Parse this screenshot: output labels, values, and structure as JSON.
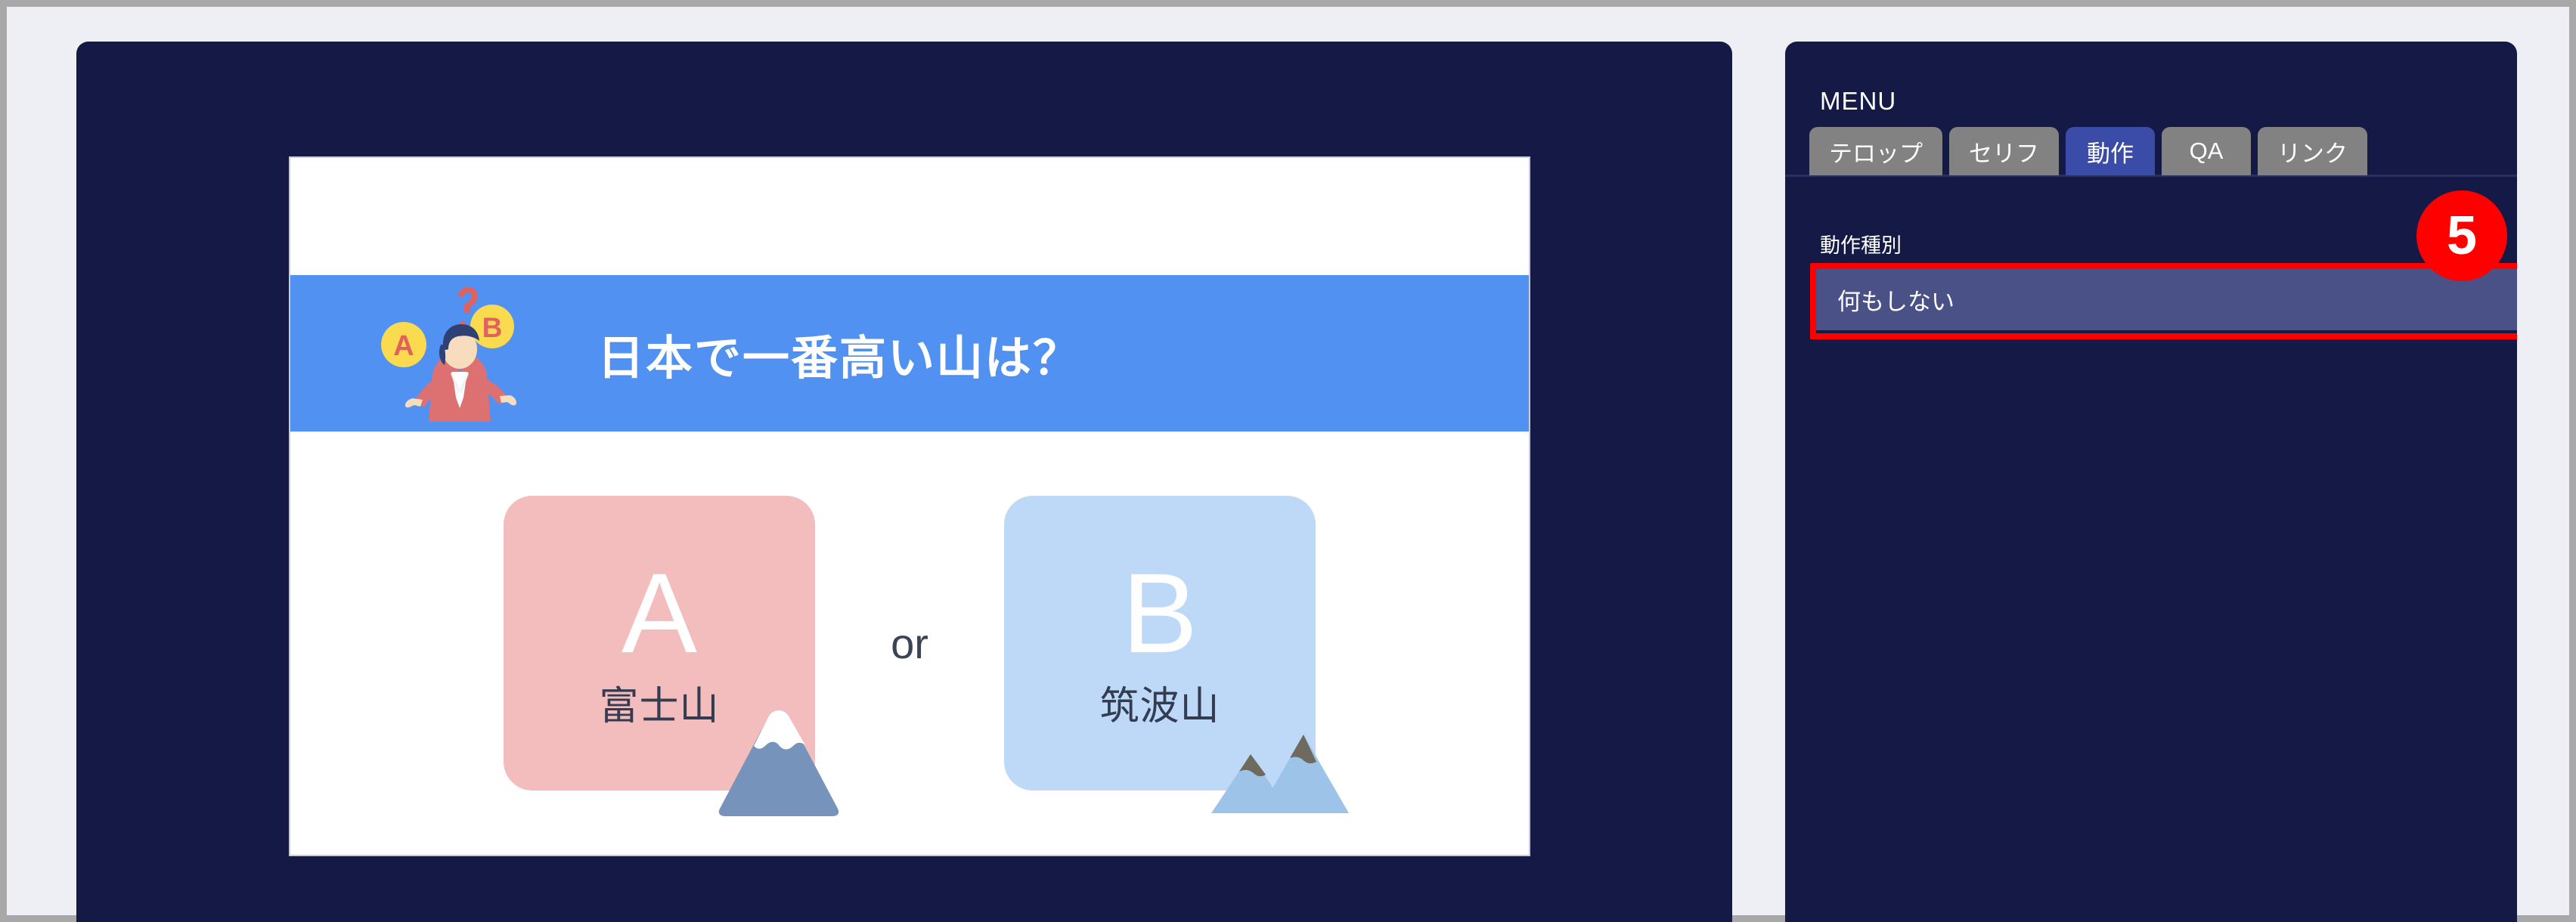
{
  "window": {
    "background_color": "#edeff4",
    "frame_color": "#a8a8a8"
  },
  "preview": {
    "panel_color": "#141a45",
    "slide": {
      "background_color": "#ffffff",
      "title_band_color": "#5191f2",
      "title": "日本で一番高い山は？",
      "illustration_name": "quiz-person-ab-illustration",
      "illustration_badges": [
        "A",
        "B",
        "?"
      ],
      "answers": [
        {
          "letter": "A",
          "label": "富士山",
          "card_color": "#f4bdbd",
          "icon": "fuji-mountain-icon"
        },
        {
          "letter": "B",
          "label": "筑波山",
          "card_color": "#bed9f7",
          "icon": "twin-peak-mountain-icon"
        }
      ],
      "separator_text": "or"
    }
  },
  "menu": {
    "panel_color": "#141a45",
    "heading": "MENU",
    "tabs": [
      {
        "label": "テロップ",
        "active": false
      },
      {
        "label": "セリフ",
        "active": false
      },
      {
        "label": "動作",
        "active": true
      },
      {
        "label": "QA",
        "active": false
      },
      {
        "label": "リンク",
        "active": false
      }
    ],
    "active_tab_color": "#3a4ca8",
    "inactive_tab_color": "#828282",
    "field": {
      "label": "動作種別",
      "selected_value": "何もしない",
      "options": [
        "何もしない"
      ],
      "chevron_icon": "chevron-down-icon",
      "highlight_color": "#ff0000",
      "field_color": "#4a5187"
    }
  },
  "annotation": {
    "step_number": "5",
    "badge_color": "#ff0000"
  }
}
